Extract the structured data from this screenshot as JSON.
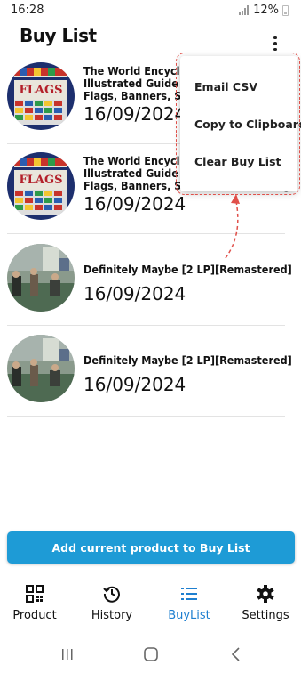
{
  "status": {
    "time": "16:28",
    "battery": "12%"
  },
  "header": {
    "title": "Buy List"
  },
  "items": [
    {
      "title_line1": "The World Encyclop",
      "title_line2": "Illustrated Guide to",
      "title_line3": "Flags, Banners, Sta",
      "date": "16/09/2024",
      "thumb": "flags-book-cover"
    },
    {
      "title_line1": "The World Encyclop",
      "title_line2": "Illustrated Guide to",
      "title_line3": "Flags, Banners, Standards and Ensigns",
      "date": "16/09/2024",
      "thumb": "flags-book-cover"
    },
    {
      "title": "Definitely Maybe [2 LP][Remastered]",
      "date": "16/09/2024",
      "thumb": "album-cover"
    },
    {
      "title": "Definitely Maybe [2 LP][Remastered]",
      "date": "16/09/2024",
      "thumb": "album-cover"
    }
  ],
  "menu": {
    "items": [
      "Email CSV",
      "Copy to Clipboard",
      "Clear Buy List"
    ]
  },
  "add_button": {
    "label": "Add current product to Buy List"
  },
  "nav": [
    {
      "label": "Product",
      "icon": "qr-code-icon"
    },
    {
      "label": "History",
      "icon": "history-icon"
    },
    {
      "label": "BuyList",
      "icon": "list-icon",
      "active": true
    },
    {
      "label": "Settings",
      "icon": "gear-icon"
    }
  ],
  "colors": {
    "accent": "#1e9bd6",
    "active_nav": "#1e7fd0",
    "annotation": "#e0504a"
  }
}
